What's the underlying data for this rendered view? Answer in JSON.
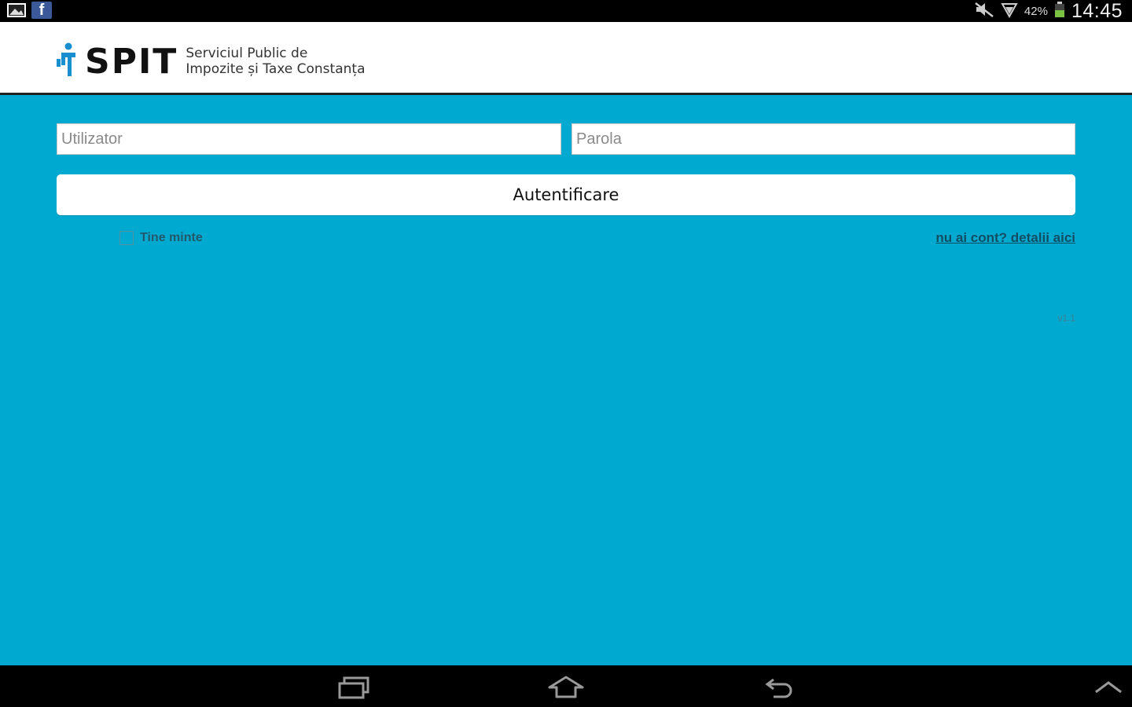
{
  "status_bar": {
    "notifications": [
      "gallery-icon",
      "facebook-icon"
    ],
    "facebook_glyph": "f",
    "battery_percent": "42%",
    "time": "14:45"
  },
  "header": {
    "brand": "SPIT",
    "subtitle_line1": "Serviciul Public de",
    "subtitle_line2": "Impozite și Taxe Constanța"
  },
  "login": {
    "username_placeholder": "Utilizator",
    "password_placeholder": "Parola",
    "submit_label": "Autentificare",
    "remember_label": "Tine minte",
    "details_link": "nu ai cont? detalii aici"
  },
  "version": "v1.1",
  "nav_bar": {
    "buttons": [
      "recent-apps-icon",
      "home-icon",
      "back-icon",
      "chevron-up-icon"
    ]
  },
  "colors": {
    "background": "#00a9d0",
    "brand_accent": "#1a8fd0"
  }
}
